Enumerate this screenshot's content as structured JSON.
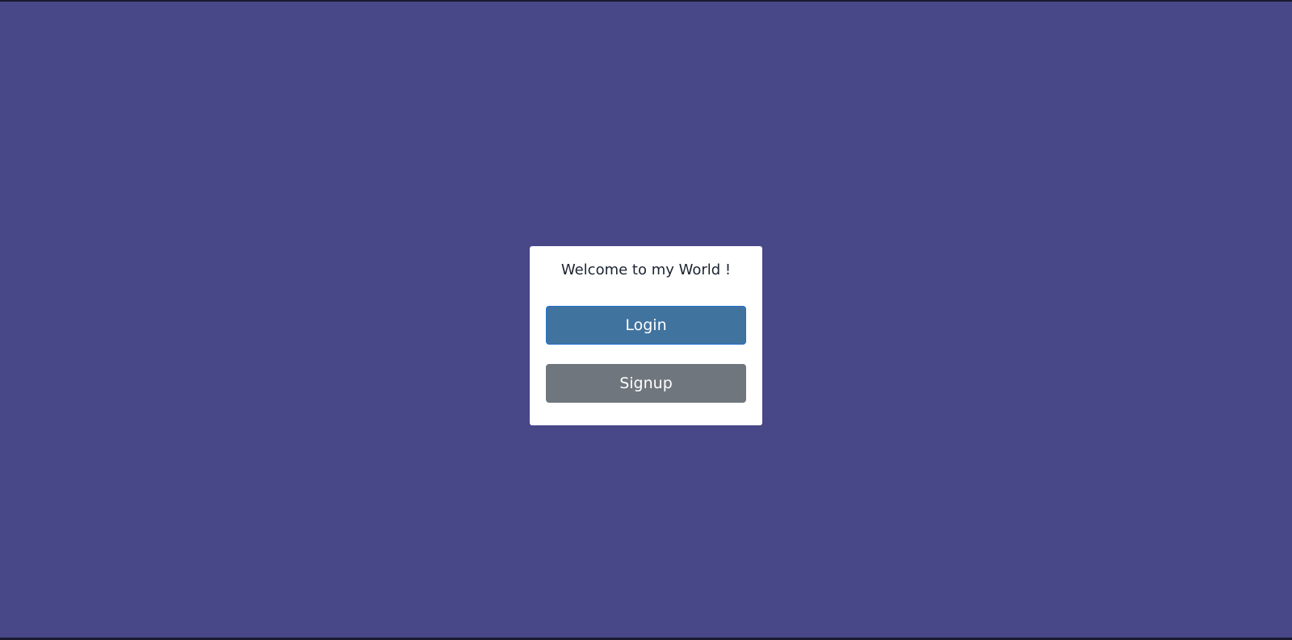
{
  "page": {
    "background_color": "#484787"
  },
  "card": {
    "welcome_text": "Welcome to my World !",
    "login_label": "Login",
    "signup_label": "Signup",
    "login_color": "#41739f",
    "signup_color": "#6f767e"
  }
}
